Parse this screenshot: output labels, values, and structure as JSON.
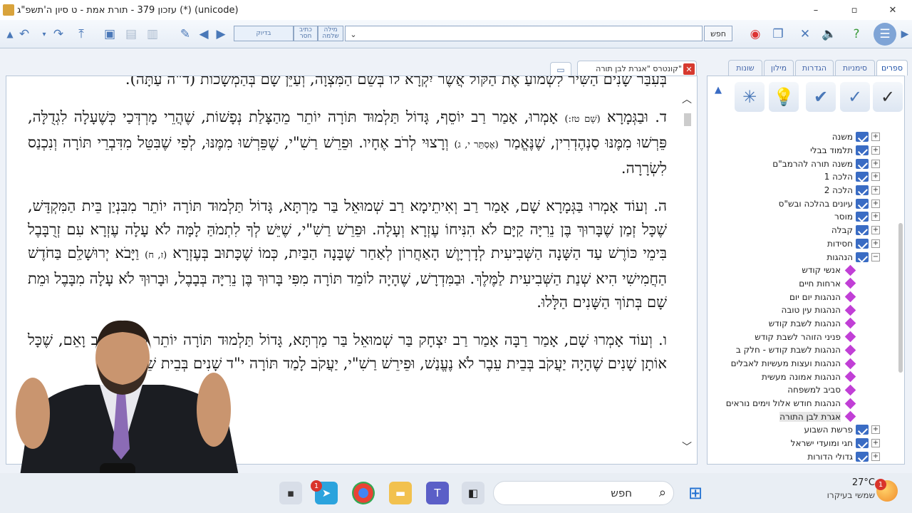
{
  "window": {
    "title": "עזכון 379 - תורת אמת - ט סיון ה'תשפ\"ג     (*)     (unicode)",
    "controls": [
      "–",
      "▫",
      "✕"
    ]
  },
  "toolbar": {
    "mode_exact": "בדיוק",
    "mode_missing_letter": "כתיב חסר",
    "mode_whole_word": "מילה שלמה",
    "search_value": "",
    "search_button": "חפש"
  },
  "doc_tab": {
    "label": "קונטרס \"אגרת לבן תורה\""
  },
  "document": {
    "fragment_top": "בְּעִבַּר שָׁנִים הַשִּׁיר לִשְׁמוֹעַ אֶת הַקּוֹל אֲשֶׁר יִקְרָא לוֹ בְּשֵׁם הַמִּצְוָה, וְעַיֵּן שָׁם בְּהַמְשָׁכוֹת",
    "fragment_note": "(ד\"ה עַתָּה).",
    "p_d_letter": "ד.",
    "p_d_a": "וּבַגְּמָרָא",
    "p_d_src1": "(שָׁם טז:)",
    "p_d_b": "אָמְרוּ, אָמַר רַב יוֹסֵף, גָּדוֹל תַּלְמוּד תּוֹרָה יוֹתֵר מֵהַצָּלַת נְפָשׁוֹת, שֶׁהֲרֵי מָרְדְּכַי כְּשֶׁעָלָה לִגְדֻלָּה, פֵּרְשׁוּ מִמֶּנּוּ סַנְהֶדְרִין, שֶׁנֶּאֱמַר",
    "p_d_src2": "(אֶסְתֵּר י, ג)",
    "p_d_c": "וְרָצוּי לְרֹב אֶחָיו. וּפֵרֵשׁ רַשִׁ\"י, שֶׁפֵּרְשׁוּ מִמֶּנּוּ, לְפִי שֶׁבִּטֵּל מִדִּבְרֵי תּוֹרָה וְנִכְנַס לִשְׂרָרָה.",
    "p_h_letter": "ה.",
    "p_h_a": "וְעוֹד אָמְרוּ בַּגְּמָרָא שָׁם, אָמַר רַב וְאִיתֵימָא רַב שְׁמוּאֵל בַּר מַרְתָּא, גָּדוֹל תַּלְמוּד תּוֹרָה יוֹתֵר מִבִּנְיַן בֵּית הַמִּקְדָּשׁ, שֶׁכָּל זְמַן שֶׁבָּרוּךְ בֶּן נֵרִיָּה קַיָּם לֹא הִנִּיחוֹ עֶזְרָא וְעָלָה. וּפֵרֵשׁ רַשִׁ\"י, שֶׁיֵּשׁ לְךָ לִתְמֹהַּ לָמָּה לֹא עָלָה עֶזְרָא עִם זְרֻבָּבֶל בִּימֵי כּוֹרֶשׁ עַד הַשָּׁנָה הַשְּׁבִיעִית לְדָרְיָוֶשׁ הָאַחֲרוֹן לְאַחַר שֶׁבָּנָה הַבַּיִת, כְּמוֹ שֶׁכָּתוּב בְּעֶזְרָא",
    "p_h_src": "(ז, ח)",
    "p_h_b": "וַיָּבֹא יְרוּשָׁלִַם בַּחֹדֶשׁ הַחֲמִישִׁי הִיא שְׁנַת הַשְּׁבִיעִית לַמֶּלֶךְ. וּבַמִּדְרָשׁ, שֶׁהָיָה לוֹמֵד תּוֹרָה מִפִּי בָּרוּךְ בֶּן נֵרִיָּה בְּבָבֶל, וּבָרוּךְ לֹא עָלָה מִבָּבֶל וּמֵת שָׁם בְּתוֹךְ הַשָּׁנִים הַלָּלוּ.",
    "p_v_letter": "ו.",
    "p_v_a": "וְעוֹד אָמְרוּ שָׁם, אָמַר רַבָּה אָמַר רַב יִצְחָק בַּר שְׁמוּאֵל בַּר מַרְתָּא, גָּדוֹל תַּלְמוּד תּוֹרָה יוֹתֵר מִכִּבּוּד אָב וָאֵם, שֶׁכָּל אוֹתָן שָׁנִים שֶׁהָיָה יַעֲקֹב בְּבֵית עֵבֶר לֹא נֶעֱנַשׁ, וּפֵירֵשׁ רַשִׁ\"י, יַעֲקֹב לָמַד תּוֹרָה י\"ד שָׁנִים בְּבֵית שֵׁם וָעֵבֶר,"
  },
  "side_tabs": [
    "ספרים",
    "סימניות",
    "הגדרות",
    "מילון",
    "שונות"
  ],
  "tree": [
    {
      "label": "משנה",
      "type": "folder",
      "exp": "+"
    },
    {
      "label": "תלמוד בבלי",
      "type": "folder",
      "exp": "+"
    },
    {
      "label": "משנה תורה להרמב\"ם",
      "type": "folder",
      "exp": "+"
    },
    {
      "label": "הלכה 1",
      "type": "folder",
      "exp": "+"
    },
    {
      "label": "הלכה 2",
      "type": "folder",
      "exp": "+"
    },
    {
      "label": "עיונים בהלכה ובש\"ס",
      "type": "folder",
      "exp": "+"
    },
    {
      "label": "מוסר",
      "type": "folder",
      "exp": "+"
    },
    {
      "label": "קבלה",
      "type": "folder",
      "exp": "+"
    },
    {
      "label": "חסידות",
      "type": "folder",
      "exp": "+"
    },
    {
      "label": "הנהגות",
      "type": "folder",
      "exp": "−"
    },
    {
      "label": "אנשי קודש",
      "type": "book"
    },
    {
      "label": "ארחות חיים",
      "type": "book"
    },
    {
      "label": "הנהגות יום יום",
      "type": "book"
    },
    {
      "label": "הנהגות עין טובה",
      "type": "book"
    },
    {
      "label": "הנהגות לשבת קודש",
      "type": "book"
    },
    {
      "label": "פניני הזוהר לשבת קודש",
      "type": "book"
    },
    {
      "label": "הנהגות לשבת קודש - חלק ב",
      "type": "book"
    },
    {
      "label": "הנהגות ועצות מעשיות לאבלים",
      "type": "book"
    },
    {
      "label": "הנהגות אמונה מעשית",
      "type": "book"
    },
    {
      "label": "סביב למשפחה",
      "type": "book"
    },
    {
      "label": "הנהגות חודש אלול וימים נוראים",
      "type": "book"
    },
    {
      "label": "אגרת לבן התורה",
      "type": "book",
      "selected": true
    },
    {
      "label": "פרשת השבוע",
      "type": "folder",
      "exp": "+"
    },
    {
      "label": "חגי ומועדי ישראל",
      "type": "folder",
      "exp": "+"
    },
    {
      "label": "גדולי הדורות",
      "type": "folder",
      "exp": "+"
    }
  ],
  "taskbar": {
    "search_placeholder": "חפש",
    "weather_temp": "27°C",
    "weather_desc": "שמשי בעיקרו",
    "telegram_badge": "1",
    "weather_badge": "1"
  },
  "colors": {
    "accent": "#4a78b8",
    "book": "#c13fd6",
    "folder": "#3a6cc4",
    "close": "#d73a2f"
  }
}
